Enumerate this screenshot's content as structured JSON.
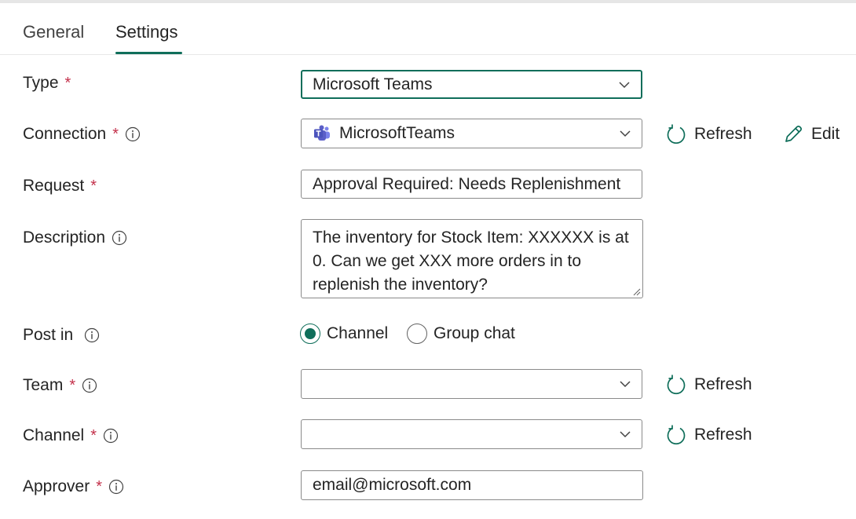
{
  "tabs": [
    {
      "label": "General",
      "active": false
    },
    {
      "label": "Settings",
      "active": true
    }
  ],
  "form": {
    "type": {
      "label": "Type",
      "required_mark": "*",
      "value": "Microsoft Teams"
    },
    "connection": {
      "label": "Connection",
      "required_mark": "*",
      "value": "MicrosoftTeams"
    },
    "request": {
      "label": "Request",
      "required_mark": "*",
      "value": "Approval Required: Needs Replenishment"
    },
    "description": {
      "label": "Description",
      "value": "The inventory for Stock Item: XXXXXX is at 0. Can we get XXX more orders in to replenish the inventory?"
    },
    "post_in": {
      "label": "Post in",
      "options": [
        "Channel",
        "Group chat"
      ],
      "selected": "Channel"
    },
    "team": {
      "label": "Team",
      "required_mark": "*",
      "value": ""
    },
    "channel": {
      "label": "Channel",
      "required_mark": "*",
      "value": ""
    },
    "approver": {
      "label": "Approver",
      "required_mark": "*",
      "value": "email@microsoft.com"
    }
  },
  "actions": {
    "refresh_label": "Refresh",
    "edit_label": "Edit"
  },
  "colors": {
    "accent": "#0f6e5a",
    "required": "#c4314b",
    "teams_brand": "#5b5fc7"
  },
  "icons": [
    "info-icon",
    "chevron-down-icon",
    "refresh-icon",
    "edit-pencil-icon",
    "teams-icon",
    "resize-grip-icon"
  ]
}
